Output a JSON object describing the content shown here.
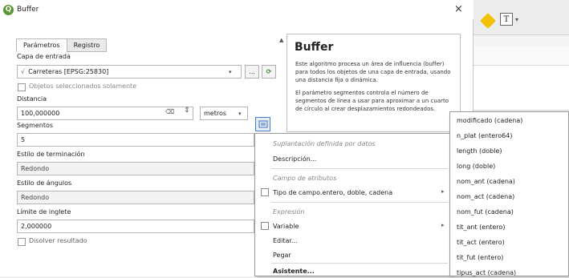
{
  "window": {
    "title": "Buffer",
    "close": "×"
  },
  "tabs": [
    "Parámetros",
    "Registro"
  ],
  "params": {
    "input_layer_label": "Capa de entrada",
    "input_layer_value": "Carreteras [EPSG:25830]",
    "input_layer_browse": "...",
    "selected_only": "Objetos seleccionados solamente",
    "distance_label": "Distancia",
    "distance_value": "100,000000",
    "distance_unit": "metros",
    "segments_label": "Segmentos",
    "segments_value": "5",
    "end_style_label": "Estilo de terminación",
    "end_style_value": "Redondo",
    "join_style_label": "Estilo de ángulos",
    "join_style_value": "Redondo",
    "miter_label": "Límite de inglete",
    "miter_value": "2,000000",
    "dissolve": "Disolver resultado"
  },
  "help": {
    "title": "Buffer",
    "p1": "Este algoritmo procesa un área de influencia (buffer) para todos los objetos de una capa de entrada, usando una distancia fija o dinámica.",
    "p2": "El parámetro segmentos controla el número de segmentos de línea a usar para aproximar a un cuarto de círculo al crear desplazamientos redondeados."
  },
  "context_menu": {
    "h1": "Suplantación definida por datos",
    "descripcion": "Descripción...",
    "h2": "Campo de atributos",
    "tipo_campo": "Tipo de campo.entero, doble, cadena",
    "h3": "Expresión",
    "variable": "Variable",
    "editar": "Editar...",
    "pegar": "Pegar",
    "asistente": "Asistente..."
  },
  "fields_submenu": [
    "modificado  (cadena)",
    "n_plat  (entero64)",
    "length  (doble)",
    "long  (doble)",
    "nom_ant  (cadena)",
    "nom_act  (cadena)",
    "nom_fut  (cadena)",
    "tit_ant  (entero)",
    "tit_act  (entero)",
    "tit_fut  (entero)",
    "tipus_act  (cadena)"
  ],
  "toolbar": {
    "text_tool": "T"
  },
  "colors": {
    "qgis_green": "#589632",
    "accent_blue": "#4a7fc0"
  }
}
